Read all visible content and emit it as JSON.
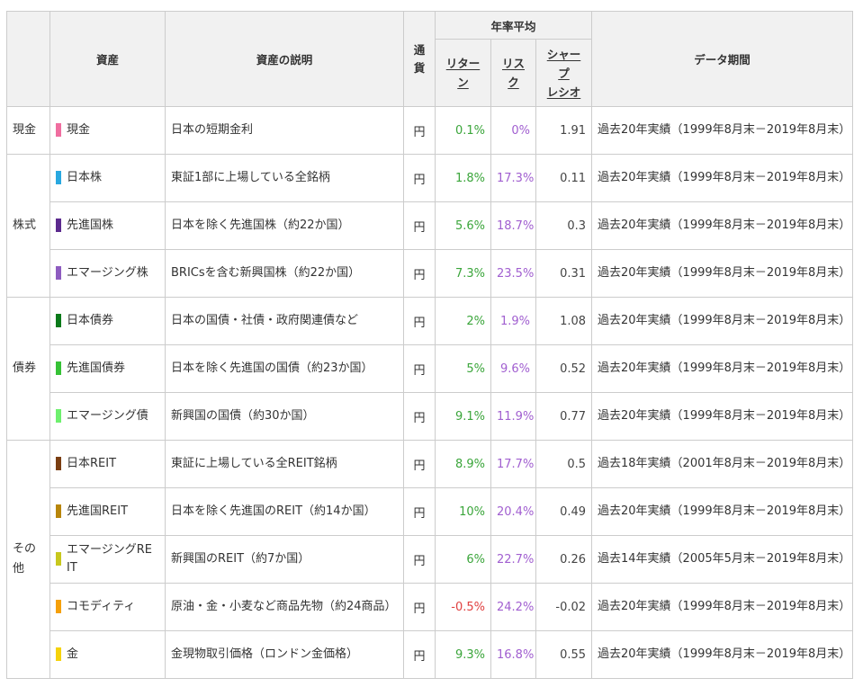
{
  "headers": {
    "asset": "資産",
    "description": "資産の説明",
    "currency": "通\n貨",
    "annual_average": "年率平均",
    "return": "リター\nン",
    "risk": "リス\nク",
    "sharpe": "シャー\nプ\nレシオ",
    "period": "データ期間"
  },
  "groups": [
    {
      "name": "現金",
      "rows": [
        {
          "color": "#f06ea0",
          "asset": "現金",
          "description": "日本の短期金利",
          "currency": "円",
          "return": "0.1%",
          "return_negative": false,
          "risk": "0%",
          "sharpe": "1.91",
          "period": "過去20年実績（1999年8月末－2019年8月末）"
        }
      ]
    },
    {
      "name": "株式",
      "rows": [
        {
          "color": "#29a8e0",
          "asset": "日本株",
          "description": "東証1部に上場している全銘柄",
          "currency": "円",
          "return": "1.8%",
          "return_negative": false,
          "risk": "17.3%",
          "sharpe": "0.11",
          "period": "過去20年実績（1999年8月末－2019年8月末）"
        },
        {
          "color": "#5c2a8e",
          "asset": "先進国株",
          "description": "日本を除く先進国株（約22か国）",
          "currency": "円",
          "return": "5.6%",
          "return_negative": false,
          "risk": "18.7%",
          "sharpe": "0.3",
          "period": "過去20年実績（1999年8月末－2019年8月末）"
        },
        {
          "color": "#8e5cc0",
          "asset": "エマージング株",
          "description": "BRICsを含む新興国株（約22か国）",
          "currency": "円",
          "return": "7.3%",
          "return_negative": false,
          "risk": "23.5%",
          "sharpe": "0.31",
          "period": "過去20年実績（1999年8月末－2019年8月末）"
        }
      ]
    },
    {
      "name": "債券",
      "rows": [
        {
          "color": "#0a7a1a",
          "asset": "日本債券",
          "description": "日本の国債・社債・政府関連債など",
          "currency": "円",
          "return": "2%",
          "return_negative": false,
          "risk": "1.9%",
          "sharpe": "1.08",
          "period": "過去20年実績（1999年8月末－2019年8月末）"
        },
        {
          "color": "#36c236",
          "asset": "先進国債券",
          "description": "日本を除く先進国の国債（約23か国）",
          "currency": "円",
          "return": "5%",
          "return_negative": false,
          "risk": "9.6%",
          "sharpe": "0.52",
          "period": "過去20年実績（1999年8月末－2019年8月末）"
        },
        {
          "color": "#6ef06e",
          "asset": "エマージング債",
          "description": "新興国の国債（約30か国）",
          "currency": "円",
          "return": "9.1%",
          "return_negative": false,
          "risk": "11.9%",
          "sharpe": "0.77",
          "period": "過去20年実績（1999年8月末－2019年8月末）"
        }
      ]
    },
    {
      "name": "その\n他",
      "rows": [
        {
          "color": "#7a3e12",
          "asset": "日本REIT",
          "description": "東証に上場している全REIT銘柄",
          "currency": "円",
          "return": "8.9%",
          "return_negative": false,
          "risk": "17.7%",
          "sharpe": "0.5",
          "period": "過去18年実績（2001年8月末－2019年8月末）"
        },
        {
          "color": "#b8860b",
          "asset": "先進国REIT",
          "description": "日本を除く先進国のREIT（約14か国）",
          "currency": "円",
          "return": "10%",
          "return_negative": false,
          "risk": "20.4%",
          "sharpe": "0.49",
          "period": "過去20年実績（1999年8月末－2019年8月末）"
        },
        {
          "color": "#c8c81e",
          "asset": "エマージングRE\nIT",
          "description": "新興国のREIT（約7か国）",
          "currency": "円",
          "return": "6%",
          "return_negative": false,
          "risk": "22.7%",
          "sharpe": "0.26",
          "period": "過去14年実績（2005年5月末－2019年8月末）"
        },
        {
          "color": "#f5a00a",
          "asset": "コモディティ",
          "description": "原油・金・小麦など商品先物（約24商品）",
          "currency": "円",
          "return": "-0.5%",
          "return_negative": true,
          "risk": "24.2%",
          "sharpe": "-0.02",
          "period": "過去20年実績（1999年8月末－2019年8月末）"
        },
        {
          "color": "#f5d20a",
          "asset": "金",
          "description": "金現物取引価格（ロンドン金価格）",
          "currency": "円",
          "return": "9.3%",
          "return_negative": false,
          "risk": "16.8%",
          "sharpe": "0.55",
          "period": "過去20年実績（1999年8月末－2019年8月末）"
        }
      ]
    }
  ]
}
